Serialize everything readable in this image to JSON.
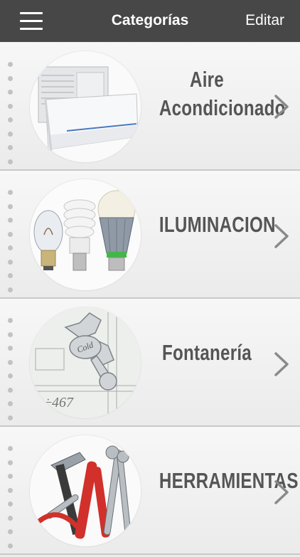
{
  "navbar": {
    "title": "Categorías",
    "edit_label": "Editar"
  },
  "categories": [
    {
      "label": "Aire Acondicionado",
      "icon": "air-conditioner-icon"
    },
    {
      "label": "ILUMINACION",
      "icon": "light-bulbs-icon"
    },
    {
      "label": "Fontanería",
      "icon": "faucet-icon"
    },
    {
      "label": "HERRAMIENTAS",
      "icon": "tools-icon"
    }
  ],
  "colors": {
    "navbar": "#474747",
    "row_bg": "#f0f0f0",
    "label": "#555555",
    "chevron": "#8a8a8a"
  }
}
